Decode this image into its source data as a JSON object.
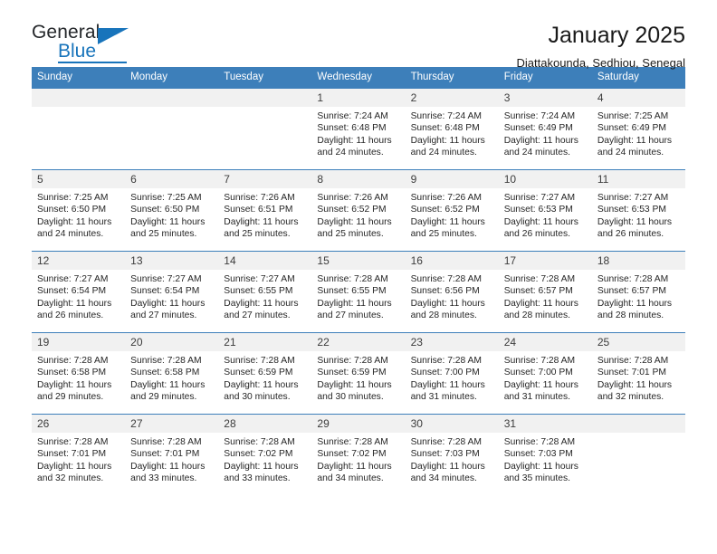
{
  "brand": {
    "name_part1": "General",
    "name_part2": "Blue",
    "accent_color": "#1874bb",
    "header_color": "#3d7fba"
  },
  "header": {
    "title": "January 2025",
    "subtitle": "Diattakounda, Sedhiou, Senegal"
  },
  "weekday_headers": [
    "Sunday",
    "Monday",
    "Tuesday",
    "Wednesday",
    "Thursday",
    "Friday",
    "Saturday"
  ],
  "labels": {
    "sunrise_prefix": "Sunrise:",
    "sunset_prefix": "Sunset:",
    "daylight_prefix": "Daylight:"
  },
  "weeks": [
    [
      {
        "day": "",
        "sunrise": "",
        "sunset": "",
        "daylight_line1": "",
        "daylight_line2": "",
        "empty": true
      },
      {
        "day": "",
        "sunrise": "",
        "sunset": "",
        "daylight_line1": "",
        "daylight_line2": "",
        "empty": true
      },
      {
        "day": "",
        "sunrise": "",
        "sunset": "",
        "daylight_line1": "",
        "daylight_line2": "",
        "empty": true
      },
      {
        "day": "1",
        "sunrise": "Sunrise: 7:24 AM",
        "sunset": "Sunset: 6:48 PM",
        "daylight_line1": "Daylight: 11 hours",
        "daylight_line2": "and 24 minutes."
      },
      {
        "day": "2",
        "sunrise": "Sunrise: 7:24 AM",
        "sunset": "Sunset: 6:48 PM",
        "daylight_line1": "Daylight: 11 hours",
        "daylight_line2": "and 24 minutes."
      },
      {
        "day": "3",
        "sunrise": "Sunrise: 7:24 AM",
        "sunset": "Sunset: 6:49 PM",
        "daylight_line1": "Daylight: 11 hours",
        "daylight_line2": "and 24 minutes."
      },
      {
        "day": "4",
        "sunrise": "Sunrise: 7:25 AM",
        "sunset": "Sunset: 6:49 PM",
        "daylight_line1": "Daylight: 11 hours",
        "daylight_line2": "and 24 minutes."
      }
    ],
    [
      {
        "day": "5",
        "sunrise": "Sunrise: 7:25 AM",
        "sunset": "Sunset: 6:50 PM",
        "daylight_line1": "Daylight: 11 hours",
        "daylight_line2": "and 24 minutes."
      },
      {
        "day": "6",
        "sunrise": "Sunrise: 7:25 AM",
        "sunset": "Sunset: 6:50 PM",
        "daylight_line1": "Daylight: 11 hours",
        "daylight_line2": "and 25 minutes."
      },
      {
        "day": "7",
        "sunrise": "Sunrise: 7:26 AM",
        "sunset": "Sunset: 6:51 PM",
        "daylight_line1": "Daylight: 11 hours",
        "daylight_line2": "and 25 minutes."
      },
      {
        "day": "8",
        "sunrise": "Sunrise: 7:26 AM",
        "sunset": "Sunset: 6:52 PM",
        "daylight_line1": "Daylight: 11 hours",
        "daylight_line2": "and 25 minutes."
      },
      {
        "day": "9",
        "sunrise": "Sunrise: 7:26 AM",
        "sunset": "Sunset: 6:52 PM",
        "daylight_line1": "Daylight: 11 hours",
        "daylight_line2": "and 25 minutes."
      },
      {
        "day": "10",
        "sunrise": "Sunrise: 7:27 AM",
        "sunset": "Sunset: 6:53 PM",
        "daylight_line1": "Daylight: 11 hours",
        "daylight_line2": "and 26 minutes."
      },
      {
        "day": "11",
        "sunrise": "Sunrise: 7:27 AM",
        "sunset": "Sunset: 6:53 PM",
        "daylight_line1": "Daylight: 11 hours",
        "daylight_line2": "and 26 minutes."
      }
    ],
    [
      {
        "day": "12",
        "sunrise": "Sunrise: 7:27 AM",
        "sunset": "Sunset: 6:54 PM",
        "daylight_line1": "Daylight: 11 hours",
        "daylight_line2": "and 26 minutes."
      },
      {
        "day": "13",
        "sunrise": "Sunrise: 7:27 AM",
        "sunset": "Sunset: 6:54 PM",
        "daylight_line1": "Daylight: 11 hours",
        "daylight_line2": "and 27 minutes."
      },
      {
        "day": "14",
        "sunrise": "Sunrise: 7:27 AM",
        "sunset": "Sunset: 6:55 PM",
        "daylight_line1": "Daylight: 11 hours",
        "daylight_line2": "and 27 minutes."
      },
      {
        "day": "15",
        "sunrise": "Sunrise: 7:28 AM",
        "sunset": "Sunset: 6:55 PM",
        "daylight_line1": "Daylight: 11 hours",
        "daylight_line2": "and 27 minutes."
      },
      {
        "day": "16",
        "sunrise": "Sunrise: 7:28 AM",
        "sunset": "Sunset: 6:56 PM",
        "daylight_line1": "Daylight: 11 hours",
        "daylight_line2": "and 28 minutes."
      },
      {
        "day": "17",
        "sunrise": "Sunrise: 7:28 AM",
        "sunset": "Sunset: 6:57 PM",
        "daylight_line1": "Daylight: 11 hours",
        "daylight_line2": "and 28 minutes."
      },
      {
        "day": "18",
        "sunrise": "Sunrise: 7:28 AM",
        "sunset": "Sunset: 6:57 PM",
        "daylight_line1": "Daylight: 11 hours",
        "daylight_line2": "and 28 minutes."
      }
    ],
    [
      {
        "day": "19",
        "sunrise": "Sunrise: 7:28 AM",
        "sunset": "Sunset: 6:58 PM",
        "daylight_line1": "Daylight: 11 hours",
        "daylight_line2": "and 29 minutes."
      },
      {
        "day": "20",
        "sunrise": "Sunrise: 7:28 AM",
        "sunset": "Sunset: 6:58 PM",
        "daylight_line1": "Daylight: 11 hours",
        "daylight_line2": "and 29 minutes."
      },
      {
        "day": "21",
        "sunrise": "Sunrise: 7:28 AM",
        "sunset": "Sunset: 6:59 PM",
        "daylight_line1": "Daylight: 11 hours",
        "daylight_line2": "and 30 minutes."
      },
      {
        "day": "22",
        "sunrise": "Sunrise: 7:28 AM",
        "sunset": "Sunset: 6:59 PM",
        "daylight_line1": "Daylight: 11 hours",
        "daylight_line2": "and 30 minutes."
      },
      {
        "day": "23",
        "sunrise": "Sunrise: 7:28 AM",
        "sunset": "Sunset: 7:00 PM",
        "daylight_line1": "Daylight: 11 hours",
        "daylight_line2": "and 31 minutes."
      },
      {
        "day": "24",
        "sunrise": "Sunrise: 7:28 AM",
        "sunset": "Sunset: 7:00 PM",
        "daylight_line1": "Daylight: 11 hours",
        "daylight_line2": "and 31 minutes."
      },
      {
        "day": "25",
        "sunrise": "Sunrise: 7:28 AM",
        "sunset": "Sunset: 7:01 PM",
        "daylight_line1": "Daylight: 11 hours",
        "daylight_line2": "and 32 minutes."
      }
    ],
    [
      {
        "day": "26",
        "sunrise": "Sunrise: 7:28 AM",
        "sunset": "Sunset: 7:01 PM",
        "daylight_line1": "Daylight: 11 hours",
        "daylight_line2": "and 32 minutes."
      },
      {
        "day": "27",
        "sunrise": "Sunrise: 7:28 AM",
        "sunset": "Sunset: 7:01 PM",
        "daylight_line1": "Daylight: 11 hours",
        "daylight_line2": "and 33 minutes."
      },
      {
        "day": "28",
        "sunrise": "Sunrise: 7:28 AM",
        "sunset": "Sunset: 7:02 PM",
        "daylight_line1": "Daylight: 11 hours",
        "daylight_line2": "and 33 minutes."
      },
      {
        "day": "29",
        "sunrise": "Sunrise: 7:28 AM",
        "sunset": "Sunset: 7:02 PM",
        "daylight_line1": "Daylight: 11 hours",
        "daylight_line2": "and 34 minutes."
      },
      {
        "day": "30",
        "sunrise": "Sunrise: 7:28 AM",
        "sunset": "Sunset: 7:03 PM",
        "daylight_line1": "Daylight: 11 hours",
        "daylight_line2": "and 34 minutes."
      },
      {
        "day": "31",
        "sunrise": "Sunrise: 7:28 AM",
        "sunset": "Sunset: 7:03 PM",
        "daylight_line1": "Daylight: 11 hours",
        "daylight_line2": "and 35 minutes."
      },
      {
        "day": "",
        "sunrise": "",
        "sunset": "",
        "daylight_line1": "",
        "daylight_line2": "",
        "empty": true
      }
    ]
  ]
}
